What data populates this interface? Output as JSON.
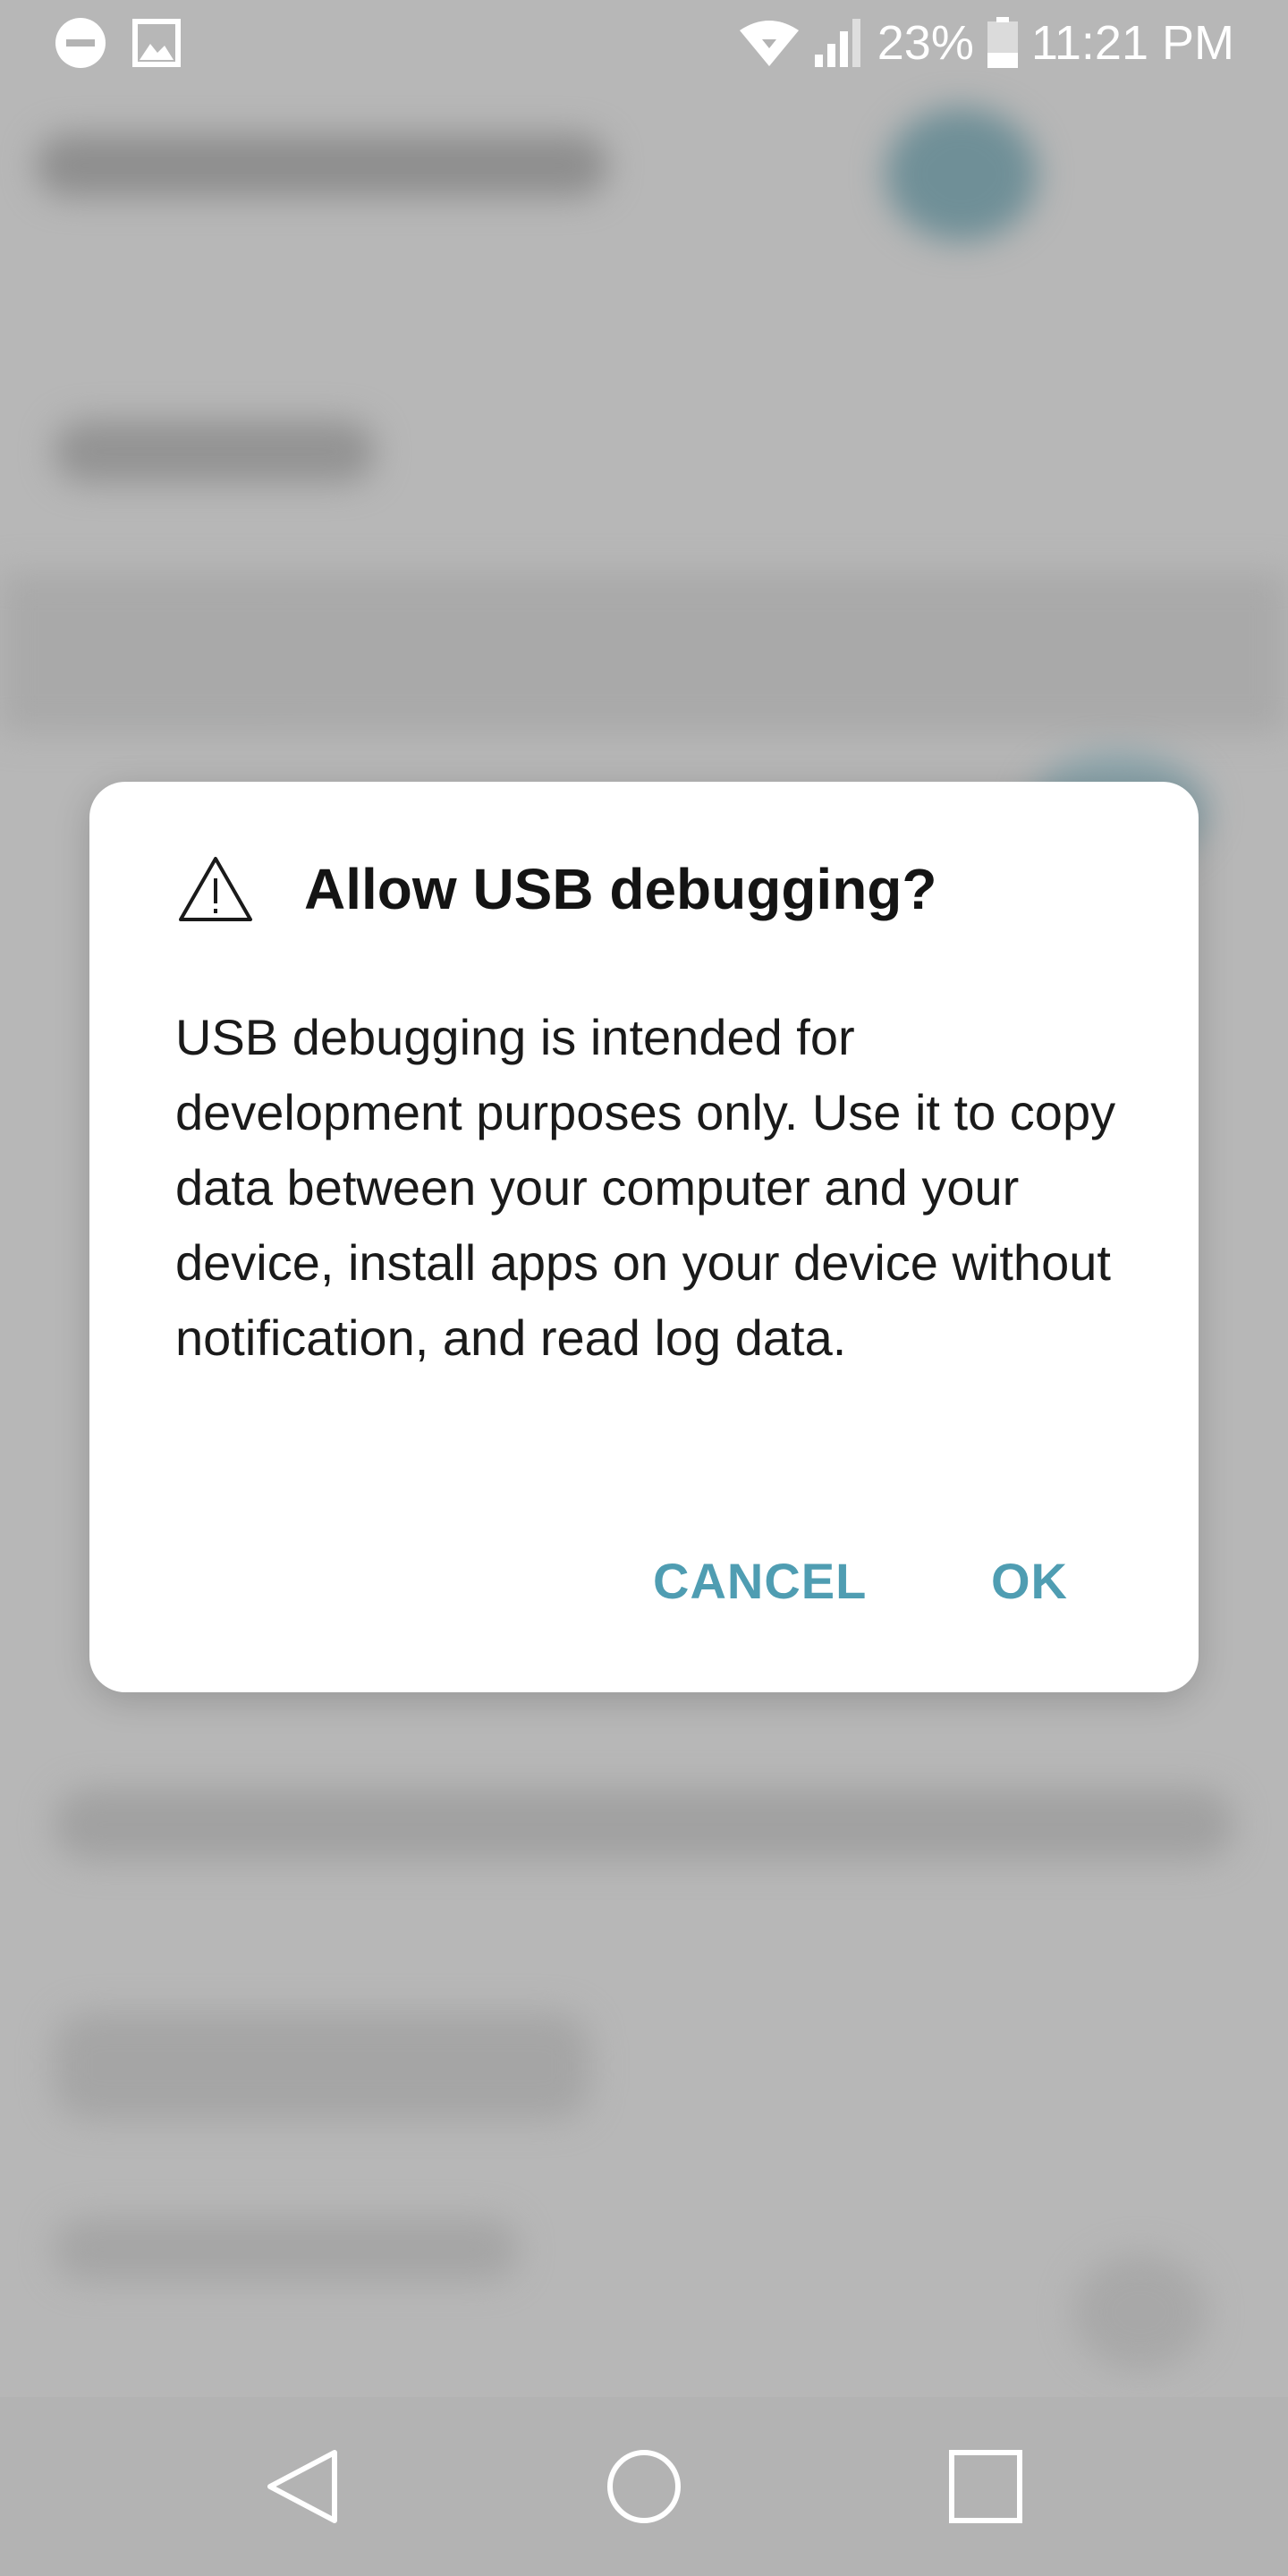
{
  "status_bar": {
    "left_icons": [
      "do-not-disturb-icon",
      "image-notification-icon"
    ],
    "right_icons": [
      "wifi-icon",
      "signal-icon",
      "battery-icon"
    ],
    "battery_percent": "23%",
    "time": "11:21 PM"
  },
  "dialog": {
    "icon": "warning-icon",
    "title": "Allow USB debugging?",
    "message": "USB debugging is intended for development purposes only. Use it to copy data between your computer and your device, install apps on your device without notification, and read log data.",
    "cancel_label": "CANCEL",
    "ok_label": "OK",
    "accent_color": "#4f9db2"
  },
  "nav_bar": {
    "buttons": [
      "back-icon",
      "home-icon",
      "recents-icon"
    ]
  }
}
